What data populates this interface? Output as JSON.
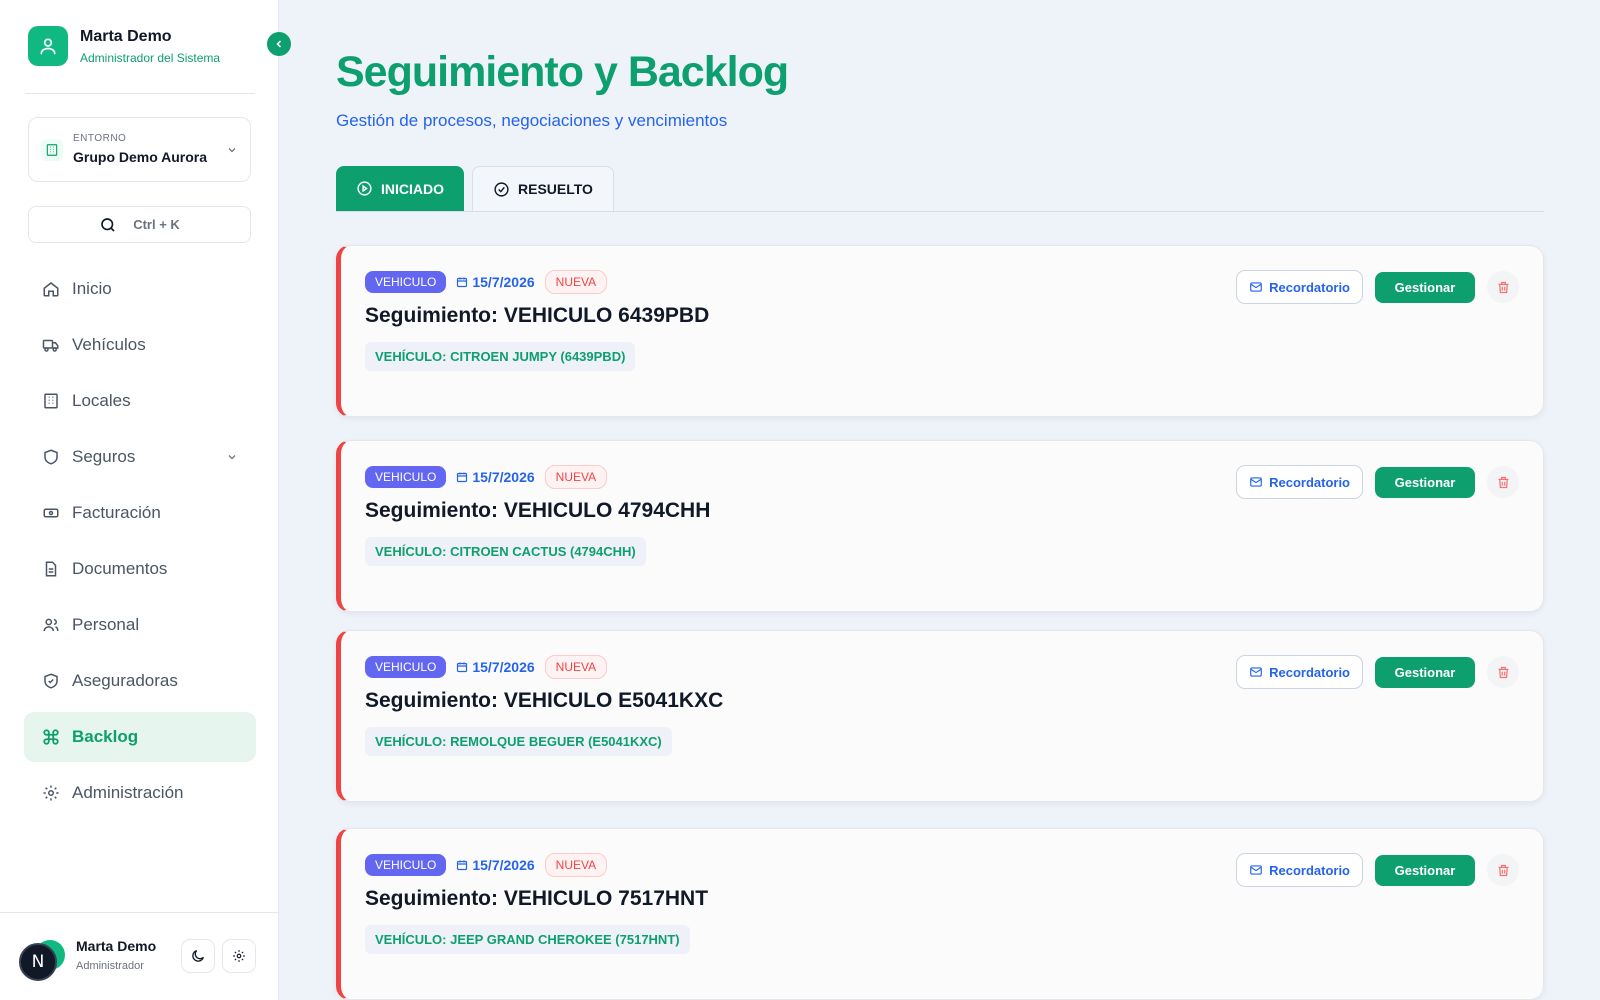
{
  "sidebar": {
    "user": {
      "name": "Marta Demo",
      "role": "Administrador del Sistema"
    },
    "environment": {
      "label": "ENTORNO",
      "value": "Grupo Demo Aurora"
    },
    "search": {
      "hint": "Ctrl + K"
    },
    "nav": [
      {
        "label": "Inicio",
        "icon": "home-icon"
      },
      {
        "label": "Vehículos",
        "icon": "truck-icon"
      },
      {
        "label": "Locales",
        "icon": "building-icon"
      },
      {
        "label": "Seguros",
        "icon": "shield-icon"
      },
      {
        "label": "Facturación",
        "icon": "banknote-icon"
      },
      {
        "label": "Documentos",
        "icon": "file-icon"
      },
      {
        "label": "Personal",
        "icon": "users-icon"
      },
      {
        "label": "Aseguradoras",
        "icon": "shield-check-icon"
      },
      {
        "label": "Backlog",
        "icon": "command-icon"
      },
      {
        "label": "Administración",
        "icon": "gear-icon"
      }
    ],
    "active_item": "Backlog",
    "footer": {
      "avatar_letter": "N",
      "name": "Marta Demo",
      "role": "Administrador"
    }
  },
  "main": {
    "title": "Seguimiento y Backlog",
    "subtitle": "Gestión de procesos, negociaciones y vencimientos",
    "tabs": [
      {
        "label": "INICIADO",
        "active": true
      },
      {
        "label": "RESUELTO",
        "active": false
      }
    ],
    "cards": [
      {
        "type": "VEHICULO",
        "date": "15/7/2026",
        "status": "NUEVA",
        "title": "Seguimiento: VEHICULO 6439PBD",
        "tag": "VEHÍCULO: CITROEN JUMPY (6439PBD)"
      },
      {
        "type": "VEHICULO",
        "date": "15/7/2026",
        "status": "NUEVA",
        "title": "Seguimiento: VEHICULO 4794CHH",
        "tag": "VEHÍCULO: CITROEN CACTUS (4794CHH)"
      },
      {
        "type": "VEHICULO",
        "date": "15/7/2026",
        "status": "NUEVA",
        "title": "Seguimiento: VEHICULO E5041KXC",
        "tag": "VEHÍCULO: REMOLQUE BEGUER (E5041KXC)"
      },
      {
        "type": "VEHICULO",
        "date": "15/7/2026",
        "status": "NUEVA",
        "title": "Seguimiento: VEHICULO 7517HNT",
        "tag": "VEHÍCULO: JEEP GRAND CHEROKEE (7517HNT)"
      }
    ],
    "actions": {
      "reminder": "Recordatorio",
      "manage": "Gestionar"
    }
  },
  "colors": {
    "brand": "#0e9f6e",
    "accent_blue": "#2563eb",
    "badge_purple": "#6366f1",
    "danger": "#ef4444",
    "background": "#eef2f9"
  }
}
